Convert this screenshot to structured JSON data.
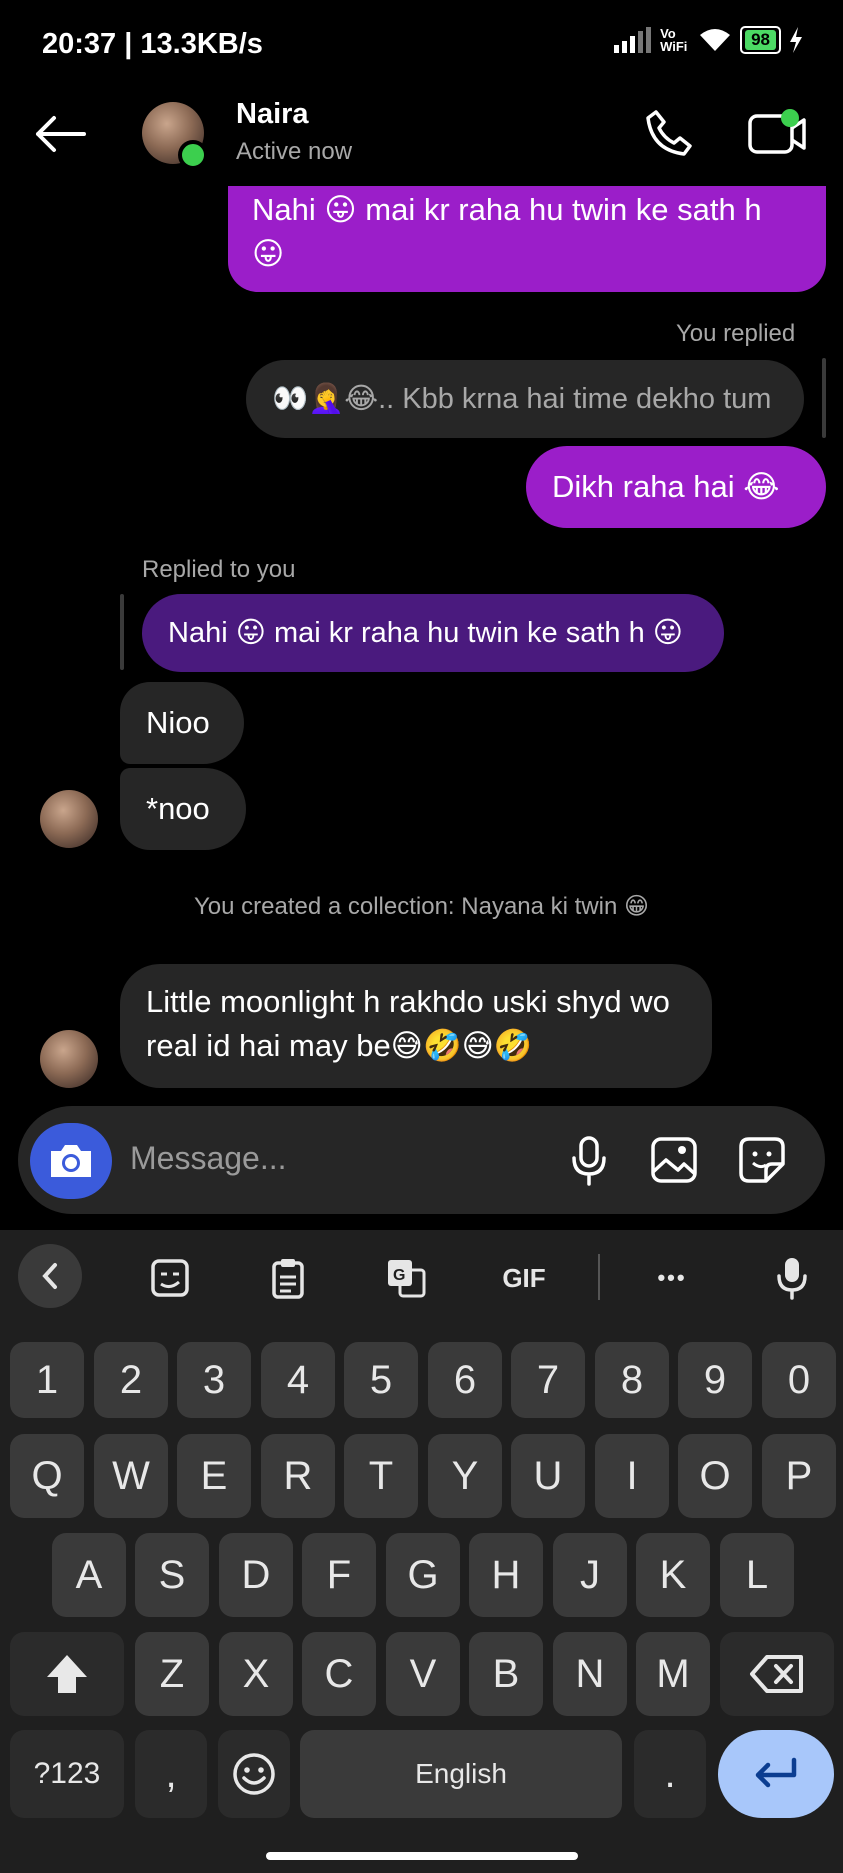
{
  "status": {
    "time": "20:37 | 13.3KB/s",
    "network": "Vo WiFi",
    "battery": "98"
  },
  "header": {
    "name": "Naira",
    "status": "Active now"
  },
  "messages": {
    "m1": "Nahi 😛 mai kr raha hu twin ke sath h 😛",
    "you_replied": "You replied",
    "quote1": "👀🤦‍♀️😂.. Kbb krna hai time dekho tum",
    "m2": "Dikh raha hai 😂",
    "replied_to_you": "Replied to you",
    "quote2": "Nahi 😛 mai kr raha hu twin ke sath h 😛",
    "m3": "Nioo",
    "m4": "*noo",
    "system": "You created a collection: Nayana ki twin 😁",
    "m5": "Little moonlight h rakhdo uski shyd wo real id hai may be😅🤣😅🤣"
  },
  "composer": {
    "placeholder": "Message..."
  },
  "keyboard": {
    "toolbar": {
      "gif": "GIF",
      "more": "•••"
    },
    "row_numbers": [
      "1",
      "2",
      "3",
      "4",
      "5",
      "6",
      "7",
      "8",
      "9",
      "0"
    ],
    "row1": [
      "Q",
      "W",
      "E",
      "R",
      "T",
      "Y",
      "U",
      "I",
      "O",
      "P"
    ],
    "row2": [
      "A",
      "S",
      "D",
      "F",
      "G",
      "H",
      "J",
      "K",
      "L"
    ],
    "row3": [
      "Z",
      "X",
      "C",
      "V",
      "B",
      "N",
      "M"
    ],
    "symbols": "?123",
    "comma": ",",
    "space": "English",
    "period": "."
  },
  "colors": {
    "outgoing": "#9b1ec9",
    "incoming": "#262626",
    "reply_quote": "#4a1a7e",
    "camera": "#3b5bdb",
    "enter_key": "#a8c7fa"
  }
}
